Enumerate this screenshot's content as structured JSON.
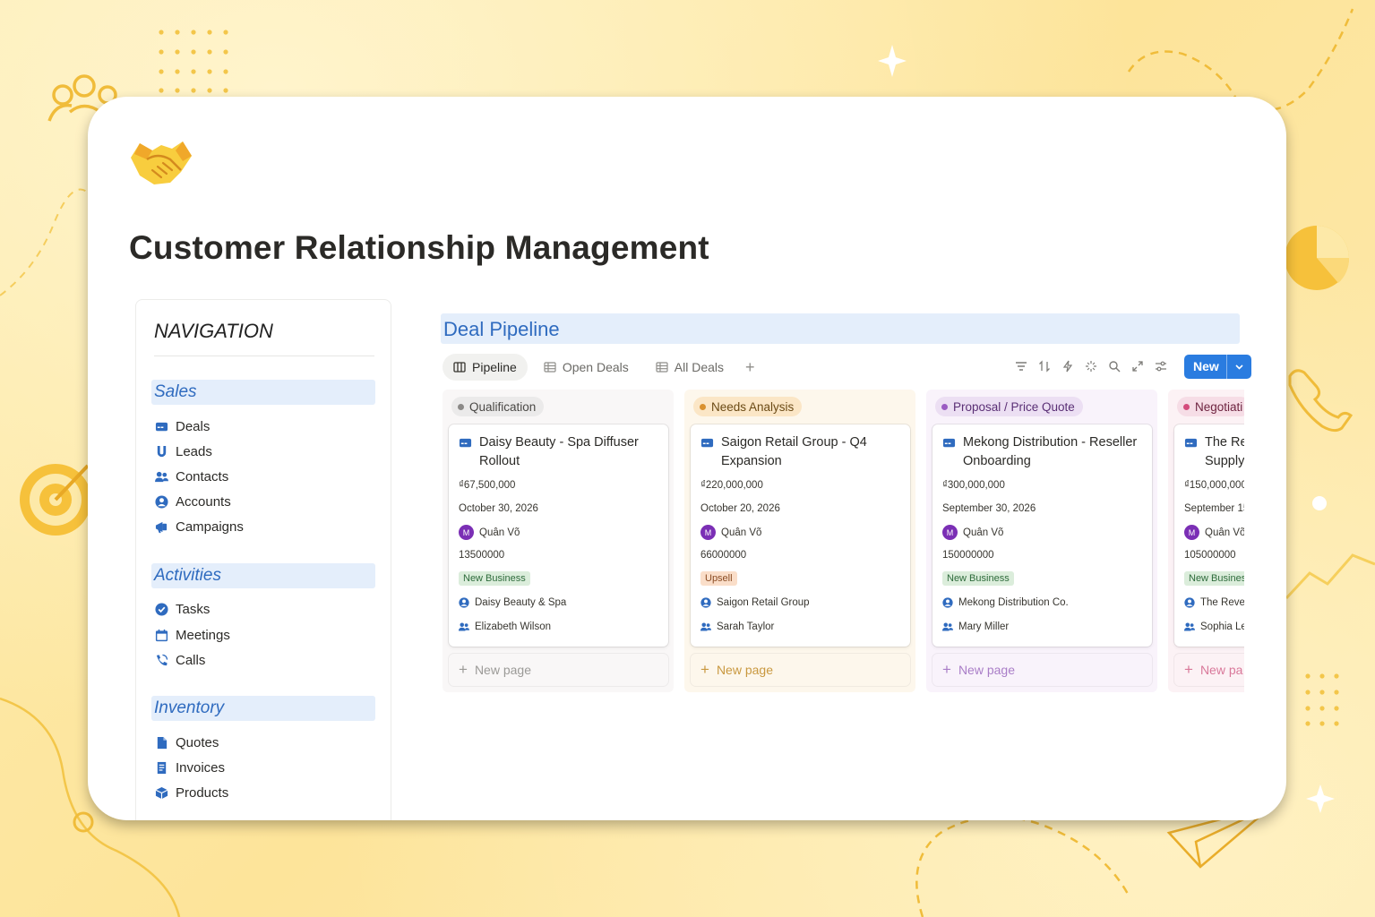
{
  "page": {
    "title": "Customer Relationship Management",
    "icon": "handshake-icon"
  },
  "navigation": {
    "title": "NAVIGATION",
    "sections": [
      {
        "label": "Sales",
        "items": [
          {
            "label": "Deals",
            "icon": "card-icon"
          },
          {
            "label": "Leads",
            "icon": "magnet-icon"
          },
          {
            "label": "Contacts",
            "icon": "people-icon"
          },
          {
            "label": "Accounts",
            "icon": "user-circle-icon"
          },
          {
            "label": "Campaigns",
            "icon": "megaphone-icon"
          }
        ]
      },
      {
        "label": "Activities",
        "items": [
          {
            "label": "Tasks",
            "icon": "check-circle-icon"
          },
          {
            "label": "Meetings",
            "icon": "calendar-icon"
          },
          {
            "label": "Calls",
            "icon": "phone-icon"
          }
        ]
      },
      {
        "label": "Inventory",
        "items": [
          {
            "label": "Quotes",
            "icon": "document-icon"
          },
          {
            "label": "Invoices",
            "icon": "receipt-icon"
          },
          {
            "label": "Products",
            "icon": "box-icon"
          }
        ]
      }
    ]
  },
  "pipeline": {
    "title": "Deal Pipeline",
    "tabs": [
      {
        "label": "Pipeline",
        "icon": "board-icon",
        "active": true
      },
      {
        "label": "Open Deals",
        "icon": "table-icon",
        "active": false
      },
      {
        "label": "All Deals",
        "icon": "table-icon",
        "active": false
      }
    ],
    "add_view_label": "+",
    "toolbar_icons": [
      "filter-icon",
      "sort-icon",
      "lightning-icon",
      "sparkle-icon",
      "search-icon",
      "expand-icon",
      "settings-icon"
    ],
    "new_button_label": "New",
    "new_page_label": "New page",
    "columns": [
      {
        "label": "Qualification",
        "bg": "#f9f7f7",
        "pill_bg": "#ebeaea",
        "dot": "#8b8987",
        "pill_text": "#4a4845",
        "new_page_color": "#9b9a97",
        "deal": {
          "title": "Daisy Beauty - Spa Diffuser Rollout",
          "amount": "₫67,500,000",
          "date": "October 30, 2026",
          "owner_initial": "M",
          "owner": "Quân Võ",
          "number": "13500000",
          "tag": "New Business",
          "tag_bg": "#dbeddb",
          "tag_fg": "#2e6b3b",
          "account": "Daisy Beauty & Spa",
          "contact": "Elizabeth Wilson"
        }
      },
      {
        "label": "Needs Analysis",
        "bg": "#fdf7ec",
        "pill_bg": "#fbe6c6",
        "dot": "#d9912f",
        "pill_text": "#6b4a15",
        "new_page_color": "#c9983f",
        "deal": {
          "title": "Saigon Retail Group - Q4 Expansion",
          "amount": "₫220,000,000",
          "date": "October 20, 2026",
          "owner_initial": "M",
          "owner": "Quân Võ",
          "number": "66000000",
          "tag": "Upsell",
          "tag_bg": "#fadec9",
          "tag_fg": "#8a4b22",
          "account": "Saigon Retail Group",
          "contact": "Sarah Taylor"
        }
      },
      {
        "label": "Proposal / Price Quote",
        "bg": "#f9f3fb",
        "pill_bg": "#ecdff3",
        "dot": "#9a5bc2",
        "pill_text": "#5a2f75",
        "new_page_color": "#a97dc7",
        "deal": {
          "title": "Mekong Distribution - Reseller Onboarding",
          "amount": "₫300,000,000",
          "date": "September 30, 2026",
          "owner_initial": "M",
          "owner": "Quân Võ",
          "number": "150000000",
          "tag": "New Business",
          "tag_bg": "#dbeddb",
          "tag_fg": "#2e6b3b",
          "account": "Mekong Distribution Co.",
          "contact": "Mary Miller"
        }
      },
      {
        "label": "Negotiati",
        "bg": "#fcf2f5",
        "pill_bg": "#f6dde6",
        "dot": "#d44c7c",
        "pill_text": "#6e2440",
        "new_page_color": "#d9789a",
        "deal": {
          "title": "The Re Supply",
          "title_line1": "The Re",
          "title_line2": "Supply",
          "amount": "₫150,000,000",
          "date": "September 15",
          "owner_initial": "M",
          "owner": "Quân Võ",
          "number": "105000000",
          "tag": "New Busines",
          "tag_bg": "#dbeddb",
          "tag_fg": "#2e6b3b",
          "account": "The Rever",
          "contact": "Sophia Le"
        },
        "new_page_label": "New pa"
      }
    ]
  }
}
